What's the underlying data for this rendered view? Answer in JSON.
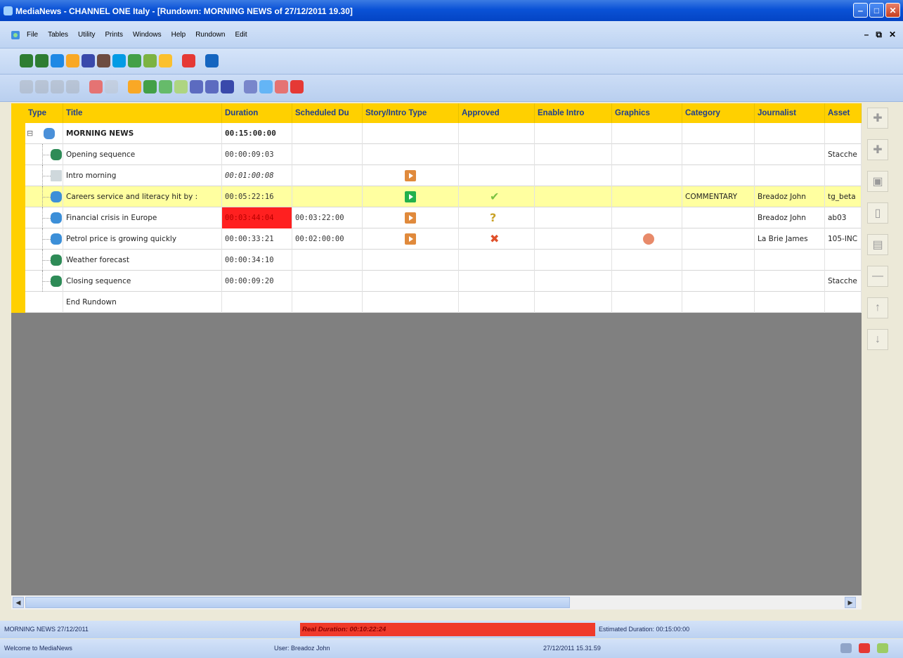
{
  "window": {
    "title": "MediaNews  - CHANNEL ONE Italy - [Rundown: MORNING NEWS of 27/12/2011 19.30]",
    "controls": [
      "minimize",
      "maximize",
      "close"
    ]
  },
  "menu": {
    "items": [
      "File",
      "Tables",
      "Utility",
      "Prints",
      "Windows",
      "Help",
      "Rundown",
      "Edit"
    ],
    "mdi_controls": [
      "-",
      "&#x25A1;",
      "x"
    ]
  },
  "toolbar1": {
    "icons": [
      {
        "name": "rundown-icon",
        "color": "#2E7D32"
      },
      {
        "name": "rundown-list-icon",
        "color": "#2E7D32"
      },
      {
        "name": "story-icon",
        "color": "#1E88E5"
      },
      {
        "name": "archive-icon",
        "color": "#F9A825"
      },
      {
        "name": "assets-icon",
        "color": "#3949AB"
      },
      {
        "name": "media-icon",
        "color": "#6D4C41"
      },
      {
        "name": "search-icon",
        "color": "#039BE5"
      },
      {
        "name": "users-icon",
        "color": "#43A047"
      },
      {
        "name": "group-icon",
        "color": "#7CB342"
      },
      {
        "name": "calendar-icon",
        "color": "#FBC02D"
      },
      {
        "name": "exit-icon",
        "color": "#E53935"
      },
      {
        "name": "help-icon",
        "color": "#1565C0"
      }
    ]
  },
  "toolbar2": {
    "icons": [
      {
        "name": "new-story-icon",
        "color": "#9E9E9E",
        "disabled": true
      },
      {
        "name": "copy-icon",
        "color": "#9E9E9E",
        "disabled": true
      },
      {
        "name": "paste-icon",
        "color": "#9E9E9E",
        "disabled": true
      },
      {
        "name": "cut-icon",
        "color": "#9E9E9E",
        "disabled": true
      },
      {
        "name": "graphics-icon",
        "color": "#E57373",
        "disabled": false
      },
      {
        "name": "clip-icon",
        "color": "#BDBDBD",
        "disabled": true
      },
      {
        "name": "approve-icon",
        "color": "#F9A825",
        "disabled": false
      },
      {
        "name": "play-icon",
        "color": "#43A047",
        "disabled": false
      },
      {
        "name": "users-icon",
        "color": "#66BB6A",
        "disabled": false
      },
      {
        "name": "assign-icon",
        "color": "#AED581",
        "disabled": false
      },
      {
        "name": "undo-icon",
        "color": "#5C6BC0",
        "disabled": false
      },
      {
        "name": "redo-icon",
        "color": "#5C6BC0",
        "disabled": false
      },
      {
        "name": "save-icon",
        "color": "#3949AB",
        "disabled": false
      },
      {
        "name": "tools-icon",
        "color": "#7986CB",
        "disabled": false
      },
      {
        "name": "move-up-icon",
        "color": "#64B5F6",
        "disabled": false
      },
      {
        "name": "move-down-icon",
        "color": "#E57373",
        "disabled": false
      },
      {
        "name": "stop-icon",
        "color": "#E53935",
        "disabled": false
      }
    ]
  },
  "grid": {
    "columns": [
      "Type",
      "Title",
      "Duration",
      "Scheduled Du",
      "Story/Intro Type",
      "Approved",
      "Enable Intro",
      "Graphics",
      "Category",
      "Journalist",
      "Asset"
    ],
    "rows": [
      {
        "type_icon": "rundown-icon",
        "title": "MORNING NEWS",
        "duration": "00:15:00:00",
        "scheduled": "",
        "story_type": "",
        "approved": "",
        "graphics": "",
        "category": "",
        "journalist": "",
        "asset": "",
        "kind": "root"
      },
      {
        "type_icon": "video-story-icon",
        "title": "Opening sequence",
        "duration": "00:00:09:03",
        "scheduled": "",
        "story_type": "",
        "approved": "",
        "graphics": "",
        "category": "",
        "journalist": "",
        "asset": "Stacche",
        "kind": "child"
      },
      {
        "type_icon": "text-page-icon",
        "title": "Intro morning",
        "duration": "00:01:00:08",
        "scheduled": "",
        "story_type": "intro",
        "approved": "",
        "graphics": "",
        "category": "",
        "journalist": "",
        "asset": "",
        "kind": "child",
        "italic_duration": true
      },
      {
        "type_icon": "story-icon",
        "title": "Careers service and literacy hit by :",
        "duration": "00:05:22:16",
        "scheduled": "",
        "story_type": "story",
        "approved": "check",
        "graphics": "",
        "category": "COMMENTARY",
        "journalist": "Breadoz John",
        "asset": "tg_beta",
        "kind": "child",
        "selected": true
      },
      {
        "type_icon": "story-icon",
        "title": "Financial crisis in Europe",
        "duration": "00:03:44:04",
        "scheduled": "00:03:22:00",
        "story_type": "intro",
        "approved": "pending",
        "graphics": "",
        "category": "",
        "journalist": "Breadoz John",
        "asset": "ab03",
        "kind": "child",
        "over": true
      },
      {
        "type_icon": "story-icon",
        "title": "Petrol price is growing quickly",
        "duration": "00:00:33:21",
        "scheduled": "00:02:00:00",
        "story_type": "intro",
        "approved": "rejected",
        "graphics": "graphics",
        "category": "",
        "journalist": "La Brie James",
        "asset": "105-INC",
        "kind": "child"
      },
      {
        "type_icon": "video-story-icon",
        "title": "Weather forecast",
        "duration": "00:00:34:10",
        "scheduled": "",
        "story_type": "",
        "approved": "",
        "graphics": "",
        "category": "",
        "journalist": "",
        "asset": "",
        "kind": "child"
      },
      {
        "type_icon": "video-story-icon",
        "title": "Closing sequence",
        "duration": "00:00:09:20",
        "scheduled": "",
        "story_type": "",
        "approved": "",
        "graphics": "",
        "category": "",
        "journalist": "",
        "asset": "Stacche",
        "kind": "child"
      },
      {
        "type_icon": "",
        "title": "End Rundown",
        "duration": "",
        "scheduled": "",
        "story_type": "",
        "approved": "",
        "graphics": "",
        "category": "",
        "journalist": "",
        "asset": "",
        "kind": "end"
      }
    ]
  },
  "right_toolbar": {
    "buttons": [
      {
        "name": "add-story-icon",
        "glyph": "✚"
      },
      {
        "name": "add-item-icon",
        "glyph": "✚"
      },
      {
        "name": "insert-icon",
        "glyph": "▣"
      },
      {
        "name": "page-icon",
        "glyph": "▯"
      },
      {
        "name": "copy-story-icon",
        "glyph": "▤"
      },
      {
        "name": "separator-icon",
        "glyph": "—"
      },
      {
        "name": "move-up-icon",
        "glyph": "↑"
      },
      {
        "name": "move-down-icon",
        "glyph": "↓"
      }
    ]
  },
  "status": {
    "rundown_label": "MORNING NEWS 27/12/2011",
    "real_duration": "Real Duration: 00:10:22:24",
    "estimated_duration": "Estimated Duration: 00:15:00:00",
    "welcome": "Welcome to MediaNews",
    "user": "User: Breadoz John",
    "datetime": "27/12/2011 15.31.59"
  },
  "colors": {
    "header": "#FFD000",
    "selected_row": "#FFFFA0",
    "over_duration": "#FF2020",
    "real_duration_bg": "#F03A2A"
  }
}
